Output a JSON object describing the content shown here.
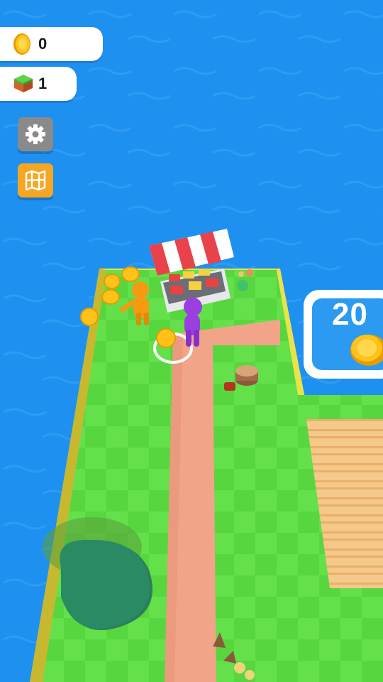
{
  "hud": {
    "coins": {
      "icon": "coin-icon",
      "value": "0"
    },
    "blocks": {
      "icon": "grass-block-icon",
      "value": "1"
    }
  },
  "buttons": {
    "settings": {
      "icon": "gear-icon",
      "color": "#8a8a8a"
    },
    "map": {
      "icon": "map-icon",
      "color": "#f5a623"
    }
  },
  "unlock_zone": {
    "price": "20",
    "icon": "coin-icon"
  },
  "colors": {
    "water": "#1e90f0",
    "grass": "#63e04a",
    "path": "#f2a489",
    "coin": "#ffc21a",
    "player": "#9b3fe0",
    "worker": "#f59a12",
    "awning_red": "#e8424a"
  }
}
